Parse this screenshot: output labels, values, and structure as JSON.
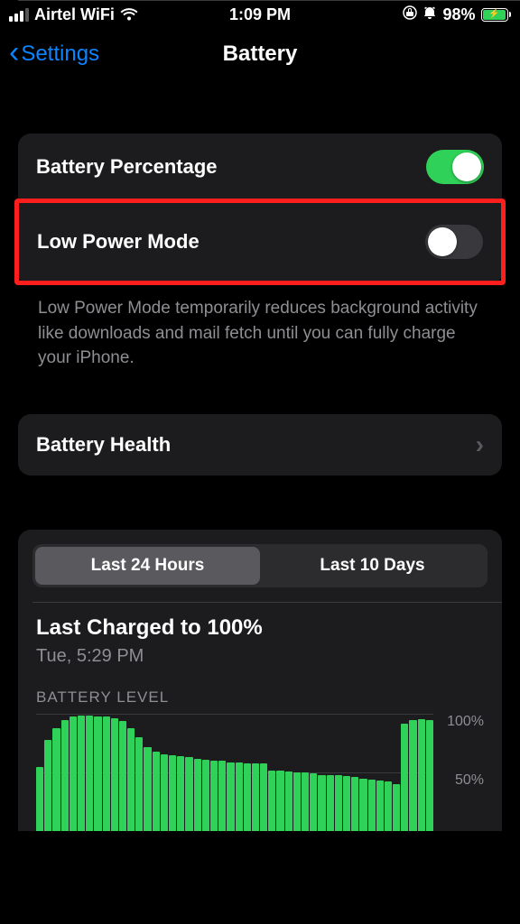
{
  "status_bar": {
    "carrier": "Airtel WiFi",
    "time": "1:09 PM",
    "battery_percent": "98%"
  },
  "nav": {
    "back_label": "Settings",
    "title": "Battery"
  },
  "settings": {
    "battery_percentage_label": "Battery Percentage",
    "battery_percentage_on": true,
    "low_power_mode_label": "Low Power Mode",
    "low_power_mode_on": false,
    "low_power_mode_desc": "Low Power Mode temporarily reduces background activity like downloads and mail fetch until you can fully charge your iPhone."
  },
  "battery_health": {
    "label": "Battery Health"
  },
  "usage": {
    "tabs": {
      "t24h": "Last 24 Hours",
      "t10d": "Last 10 Days",
      "active": "24h"
    },
    "last_charged_title": "Last Charged to 100%",
    "last_charged_sub": "Tue, 5:29 PM",
    "battery_level_label": "BATTERY LEVEL",
    "y_ticks": {
      "top": "100%",
      "mid": "50%"
    }
  },
  "chart_data": {
    "type": "bar",
    "title": "BATTERY LEVEL",
    "xlabel": "",
    "ylabel": "",
    "ylim": [
      0,
      100
    ],
    "categories_note": "48 bars over last ~24h, implicit time axis",
    "values": [
      55,
      78,
      88,
      95,
      98,
      99,
      99,
      98,
      98,
      97,
      94,
      88,
      80,
      72,
      68,
      66,
      65,
      64,
      63,
      62,
      61,
      60,
      60,
      59,
      59,
      58,
      58,
      58,
      52,
      52,
      51,
      50,
      50,
      49,
      48,
      48,
      48,
      47,
      46,
      45,
      44,
      43,
      42,
      40,
      92,
      95,
      96,
      95
    ]
  }
}
